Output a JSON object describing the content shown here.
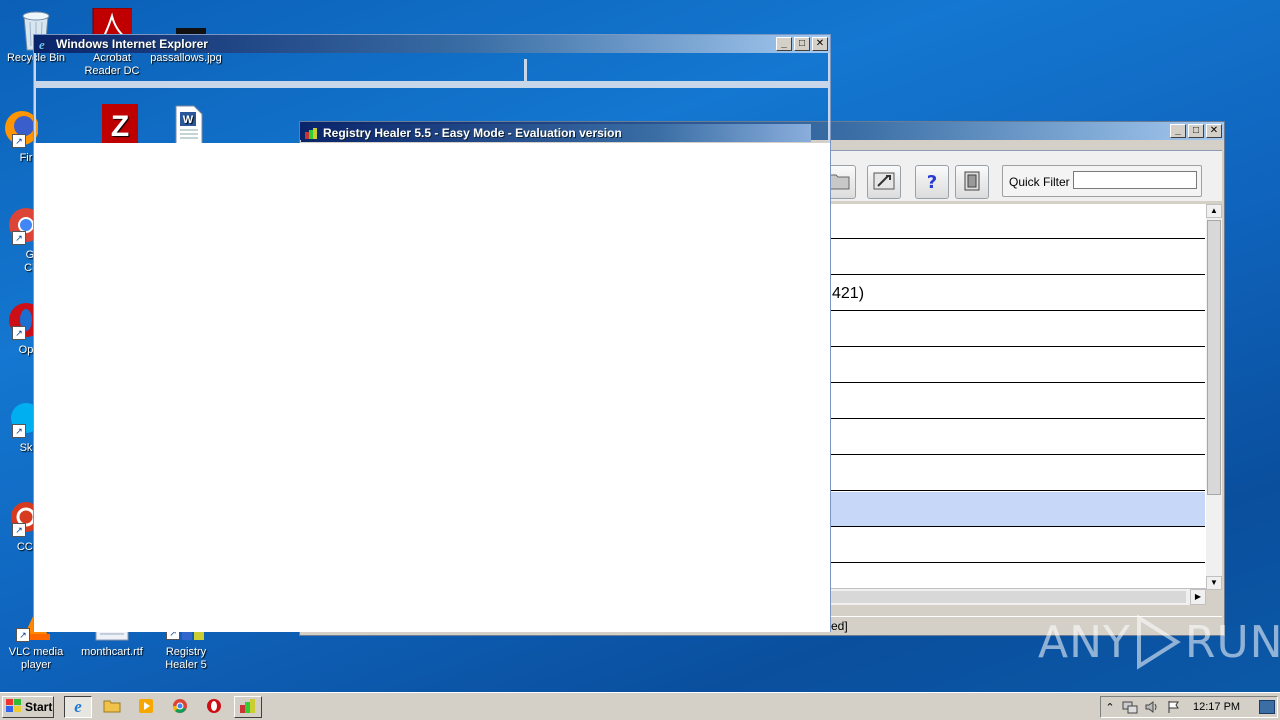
{
  "desktop": {
    "icons": [
      {
        "id": "recycle",
        "label": "Recycle Bin"
      },
      {
        "id": "acrobat",
        "label": "Acrobat Reader DC"
      },
      {
        "id": "passallows",
        "label": "passallows.jpg"
      },
      {
        "id": "firefox",
        "label": "Fir"
      },
      {
        "id": "chrome",
        "label": "Go Chr"
      },
      {
        "id": "opera",
        "label": "Op"
      },
      {
        "id": "skype",
        "label": "Sk"
      },
      {
        "id": "ccleaner",
        "label": "CCl"
      },
      {
        "id": "vlc",
        "label": "VLC media player"
      },
      {
        "id": "monthcart",
        "label": "monthcart.rtf"
      },
      {
        "id": "registry",
        "label": "Registry Healer 5"
      }
    ]
  },
  "ie_window": {
    "title": "Windows Internet Explorer",
    "buttons": {
      "minimize": "_",
      "maximize": "□",
      "close": "✕"
    }
  },
  "registry_window": {
    "title": "Registry Healer 5.5 - Easy Mode - Evaluation version",
    "buttons": {
      "minimize": "_",
      "maximize": "□",
      "close": "✕"
    },
    "quick_filter_label": "Quick Filter",
    "quick_filter_value": "",
    "rows": [
      "",
      "",
      "421)",
      "",
      "",
      "",
      "",
      "",
      "",
      "",
      "",
      ""
    ],
    "status_text": "ed]"
  },
  "watermark": {
    "text_left": "ANY",
    "text_right": "RUN"
  },
  "taskbar": {
    "start_label": "Start",
    "clock": "12:17 PM"
  },
  "colors": {
    "title_active": "#0a246a",
    "title_inactive": "#808080",
    "selected_row": "#c6d7f7"
  }
}
